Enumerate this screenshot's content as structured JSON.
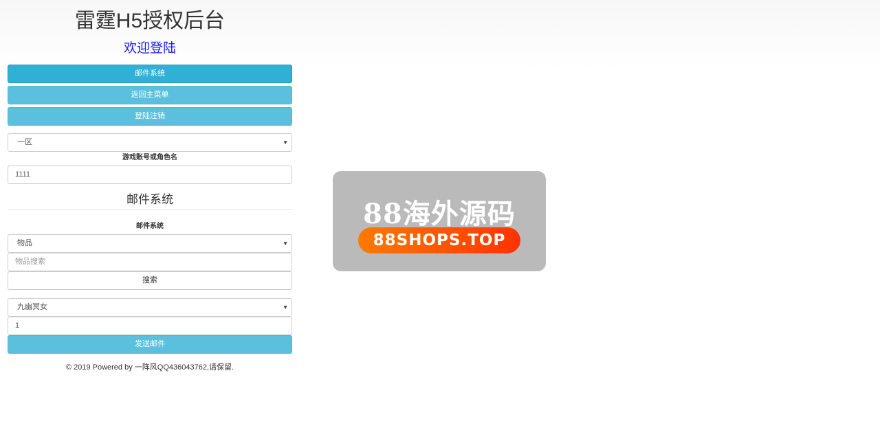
{
  "header": {
    "title": "雷霆H5授权后台",
    "welcome": "欢迎登陆"
  },
  "nav": {
    "mail_system": "邮件系统",
    "back_to_menu": "返回主菜单",
    "logout": "登陆注销"
  },
  "server_select": {
    "selected": "一区"
  },
  "account": {
    "label": "游戏账号或角色名",
    "value": "1111"
  },
  "mail": {
    "section_title": "邮件系统",
    "label": "邮件系统",
    "type_select": "物品",
    "search_placeholder": "物品搜索",
    "search_button": "搜索",
    "item_select": "九幽冥女",
    "quantity": "1",
    "send_button": "发送邮件"
  },
  "footer": {
    "text": "© 2019 Powered by 一阵风QQ436043762,请保留."
  },
  "watermark": {
    "cn_text": "88海外源码",
    "url_text": "88SHOPS.TOP"
  },
  "colors": {
    "button_info": "#5bc0de",
    "button_info_active": "#31b0d5",
    "welcome": "#1a1aff",
    "watermark_bg": "#bababa",
    "watermark_pill_start": "#ff7a00",
    "watermark_pill_end": "#ff3300"
  },
  "icons": {
    "select_arrow": "caret-down-icon"
  }
}
